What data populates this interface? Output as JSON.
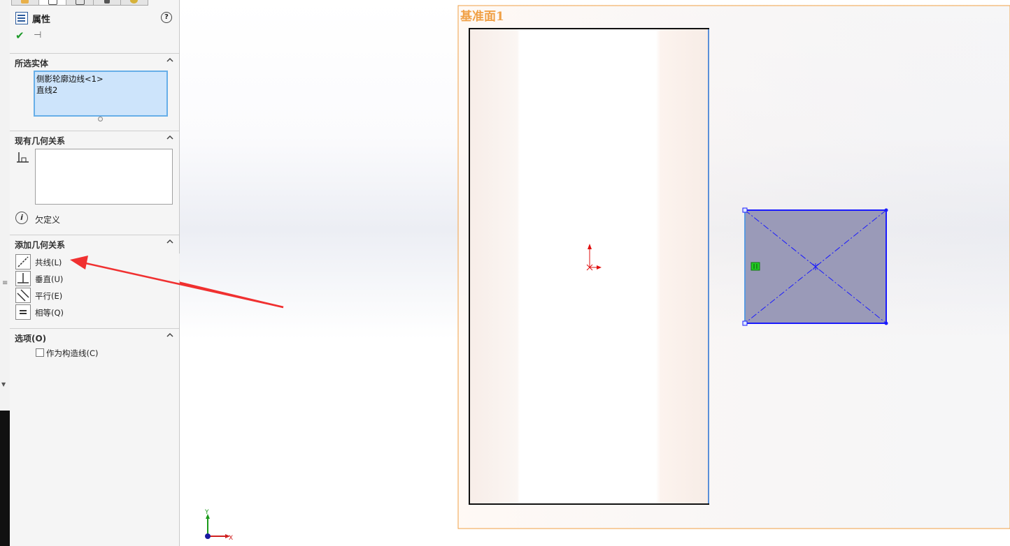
{
  "panel": {
    "title": "属性",
    "help_glyph": "?",
    "sections": {
      "selected_entities": {
        "title": "所选实体",
        "items": [
          "侧影轮廓边线<1>",
          "直线2"
        ]
      },
      "existing_relations": {
        "title": "现有几何关系",
        "status": "欠定义"
      },
      "add_relations": {
        "title": "添加几何关系",
        "items": [
          {
            "label": "共线(L)",
            "icon": "collinear-icon"
          },
          {
            "label": "垂直(U)",
            "icon": "perpendicular-icon"
          },
          {
            "label": "平行(E)",
            "icon": "parallel-icon"
          },
          {
            "label": "相等(Q)",
            "icon": "equal-icon"
          }
        ]
      },
      "options": {
        "title": "选项(O)",
        "construction_label": "作为构造线(C)",
        "construction_checked": false
      }
    }
  },
  "viewport": {
    "plane_label": "基准面1",
    "axis_labels": {
      "x": "X",
      "y": "Y"
    },
    "colors": {
      "plane_border": "#f0a046",
      "sketch_blue": "#1a1aff",
      "selected_fill": "#9a9ab8",
      "origin_red": "#e01010",
      "annotation_arrow": "#f03030"
    }
  }
}
